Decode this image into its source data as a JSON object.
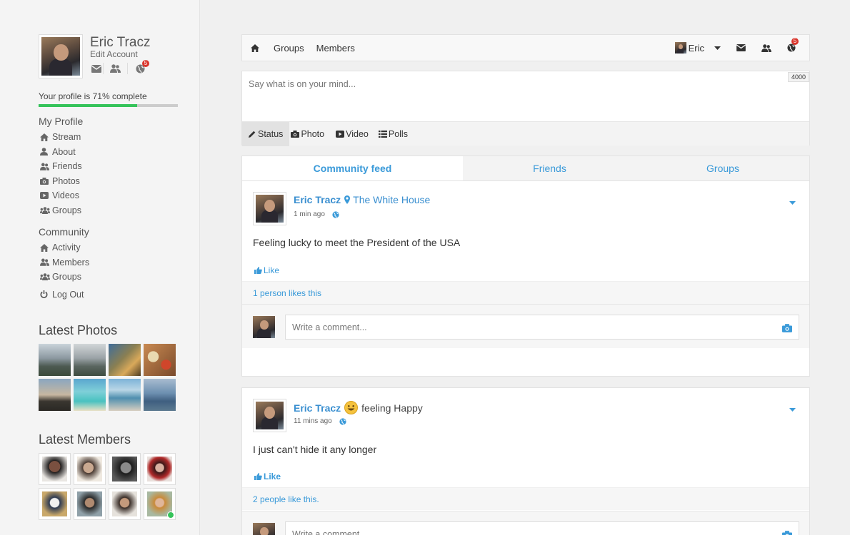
{
  "profile": {
    "name": "Eric Tracz",
    "edit_account": "Edit Account",
    "notification_count": "5",
    "progress_text": "Your profile is 71% complete",
    "progress_fraction": 0.71
  },
  "my_profile": {
    "title": "My Profile",
    "items": [
      {
        "label": "Stream",
        "icon": "home-icon"
      },
      {
        "label": "About",
        "icon": "user-icon"
      },
      {
        "label": "Friends",
        "icon": "friends-icon"
      },
      {
        "label": "Photos",
        "icon": "camera-icon"
      },
      {
        "label": "Videos",
        "icon": "video-icon"
      },
      {
        "label": "Groups",
        "icon": "groups-icon"
      }
    ]
  },
  "community": {
    "title": "Community",
    "items": [
      {
        "label": "Activity",
        "icon": "home-icon"
      },
      {
        "label": "Members",
        "icon": "friends-icon"
      },
      {
        "label": "Groups",
        "icon": "groups-icon"
      }
    ],
    "logout": "Log Out"
  },
  "latest_photos": {
    "title": "Latest Photos"
  },
  "latest_members": {
    "title": "Latest Members"
  },
  "topbar": {
    "groups": "Groups",
    "members": "Members",
    "user": "Eric",
    "notification_count": "5"
  },
  "composer": {
    "placeholder": "Say what is on your mind...",
    "char_count": "4000",
    "tools": [
      "Status",
      "Photo",
      "Video",
      "Polls"
    ]
  },
  "feed": {
    "tabs": [
      "Community feed",
      "Friends",
      "Groups"
    ],
    "posts": [
      {
        "author": "Eric Tracz",
        "location": "The White House",
        "time": "1 min ago",
        "text": "Feeling lucky to meet the President of the USA",
        "like_label": "Like",
        "likes_text": "1 person likes this",
        "comment_placeholder": "Write a comment..."
      },
      {
        "author": "Eric Tracz",
        "feeling": "feeling Happy",
        "time": "11 mins ago",
        "text": "I just can't hide it any longer",
        "like_label": "Like",
        "likes_text": "2 people like this.",
        "comment_placeholder": "Write a comment..."
      }
    ]
  },
  "colors": {
    "accent": "#3a9ad9",
    "progress": "#35c35a",
    "badge": "#d9342b",
    "online": "#35c35a"
  }
}
